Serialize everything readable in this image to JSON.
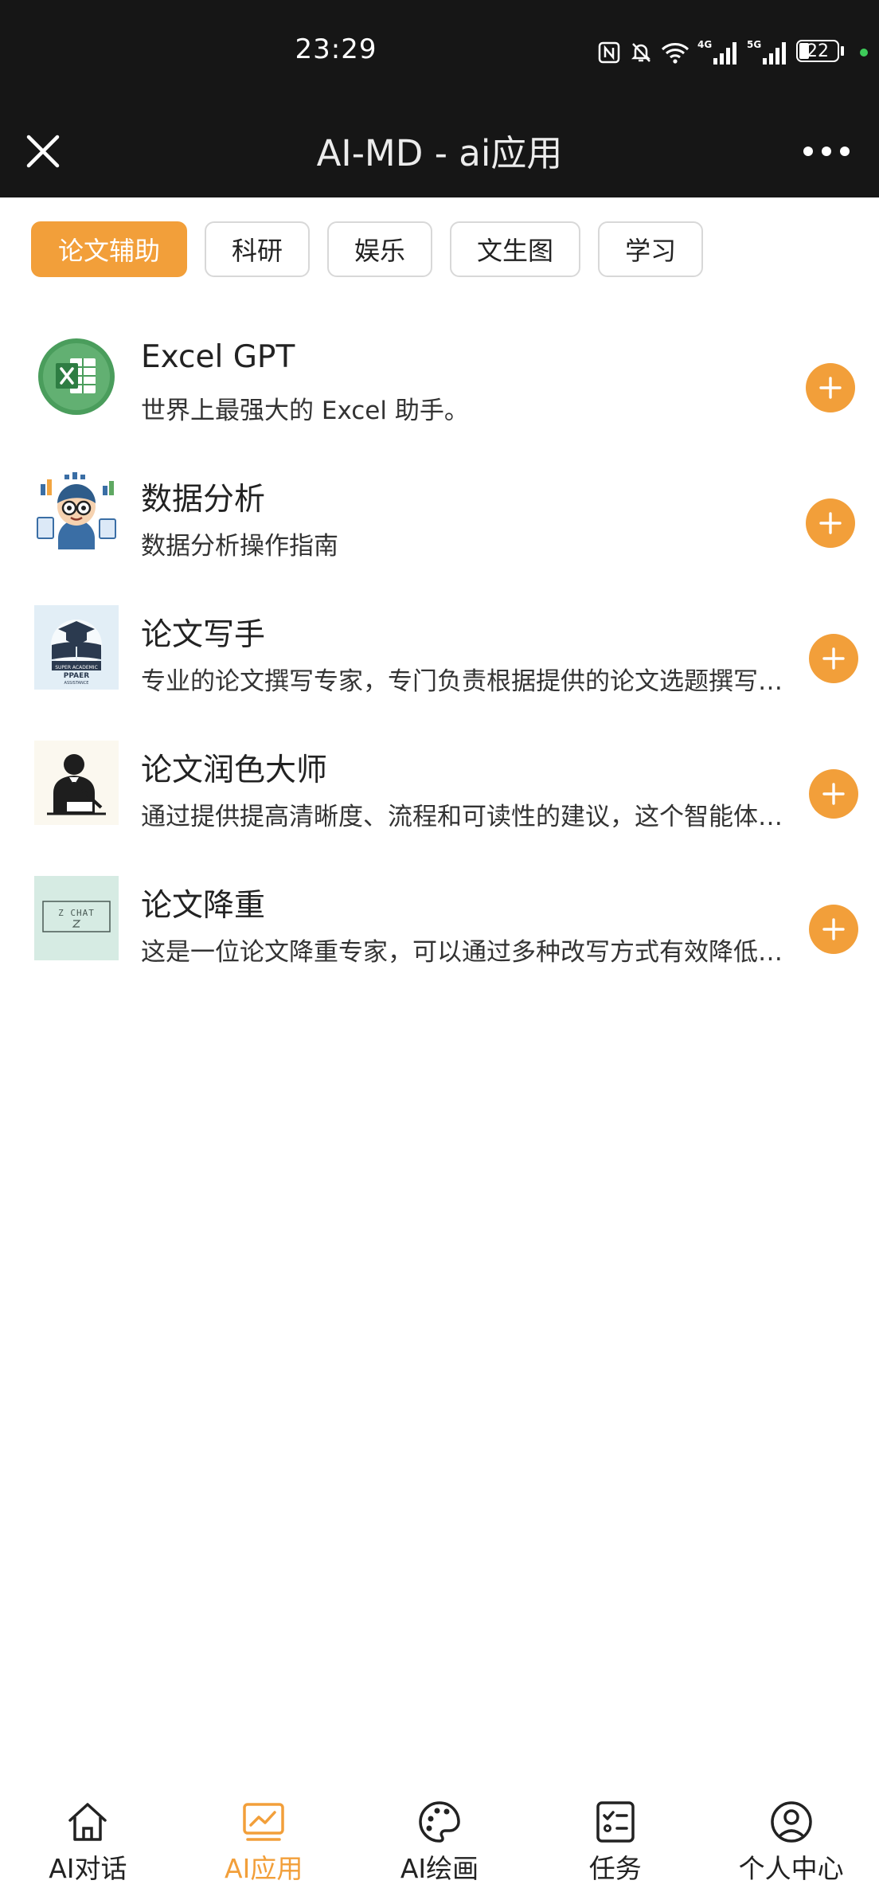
{
  "status_bar": {
    "time": "23:29",
    "battery": "22",
    "icons": [
      "nfc-icon",
      "mute-icon",
      "wifi-icon",
      "4g-signal-icon",
      "5g-signal-icon",
      "battery-icon",
      "dot-indicator-icon"
    ]
  },
  "header": {
    "title": "AI-MD - ai应用",
    "close_icon": "close-icon",
    "more_icon": "more-icon"
  },
  "tabs": [
    {
      "label": "论文辅助",
      "active": true
    },
    {
      "label": "科研",
      "active": false
    },
    {
      "label": "娱乐",
      "active": false
    },
    {
      "label": "文生图",
      "active": false
    },
    {
      "label": "学习",
      "active": false
    }
  ],
  "apps": [
    {
      "name": "Excel GPT",
      "desc": "世界上最强大的 Excel 助手。",
      "icon": "excel-icon"
    },
    {
      "name": "数据分析",
      "desc": "数据分析操作指南",
      "icon": "data-analyst-avatar-icon"
    },
    {
      "name": "论文写手",
      "desc": "专业的论文撰写专家，专门负责根据提供的论文选题撰写高质量的论文",
      "icon": "paper-writer-icon",
      "icon_text": "SUPER ACADEMIC PPAER ASSISTANCE"
    },
    {
      "name": "论文润色大师",
      "desc": "通过提供提高清晰度、流程和可读性的建议，这个智能体可以帮助你润色论文",
      "icon": "writer-silhouette-icon"
    },
    {
      "name": "论文降重",
      "desc": "这是一位论文降重专家，可以通过多种改写方式有效降低论文重复率",
      "icon": "z-chat-icon",
      "icon_text": "Z CHAT"
    }
  ],
  "bottom_nav": [
    {
      "label": "AI对话",
      "icon": "home-icon",
      "active": false
    },
    {
      "label": "AI应用",
      "icon": "chart-icon",
      "active": true
    },
    {
      "label": "AI绘画",
      "icon": "palette-icon",
      "active": false
    },
    {
      "label": "任务",
      "icon": "task-list-icon",
      "active": false
    },
    {
      "label": "个人中心",
      "icon": "user-icon",
      "active": false
    }
  ],
  "colors": {
    "accent": "#f29f3a",
    "header_bg": "#161616",
    "excel_green": "#3f9a55"
  }
}
